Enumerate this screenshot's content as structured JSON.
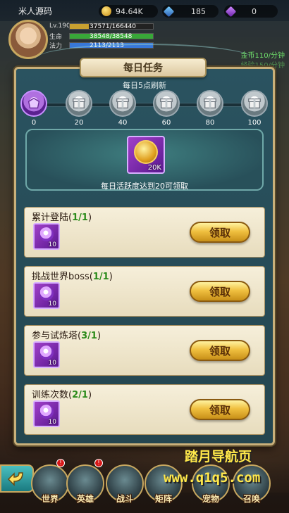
{
  "player": {
    "name": "米人源码",
    "level_label": "Lv.190",
    "exp": "37571/166440",
    "exp_fraction": 0.226,
    "hp_label": "生命",
    "hp": "38548/38548",
    "mp_label": "法力",
    "mp": "2113/2113"
  },
  "resources": {
    "gold": "94.64K",
    "gems": "185",
    "crystals": "0"
  },
  "side_info": {
    "line1": "金币110/分钟",
    "line2": "经验150/分钟"
  },
  "dialog": {
    "title": "每日任务",
    "refresh_note": "每日5点刷新",
    "progress_fraction": 0.0,
    "milestones": [
      "0",
      "20",
      "40",
      "60",
      "80",
      "100"
    ],
    "reward_qty": "20K",
    "reward_desc": "每日活跃度达到20可领取"
  },
  "tasks": [
    {
      "name": "累计登陆",
      "progress": "1/1",
      "item_qty": "10",
      "button": "领取"
    },
    {
      "name": "挑战世界boss",
      "progress": "1/1",
      "item_qty": "10",
      "button": "领取"
    },
    {
      "name": "参与试炼塔",
      "progress": "3/1",
      "item_qty": "10",
      "button": "领取"
    },
    {
      "name": "训练次数",
      "progress": "2/1",
      "item_qty": "10",
      "button": "领取"
    }
  ],
  "nav": {
    "items": [
      "世界",
      "英雄",
      "战斗",
      "矩阵",
      "宠物",
      "召唤"
    ]
  },
  "watermark": {
    "line1": "踏月导航页",
    "line2": "www.q1q5.com"
  },
  "colors": {
    "panel": "#2a5360",
    "frame": "#c9b07a",
    "claim_button": "#f0c040",
    "progress_green": "#2a8a1a"
  },
  "icons": [
    "gold-coin-icon",
    "gem-icon",
    "crystal-icon",
    "chest-icon",
    "coin-reward-icon",
    "back-arrow-icon"
  ]
}
